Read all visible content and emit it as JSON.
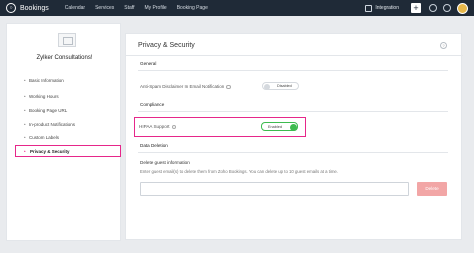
{
  "app": {
    "name": "Bookings"
  },
  "nav": {
    "items": [
      "Calendar",
      "Services",
      "Staff",
      "My Profile",
      "Booking Page"
    ]
  },
  "header": {
    "integration_label": "Integration",
    "plus_label": "+"
  },
  "sidebar": {
    "business_name": "Zylker Consultations!",
    "items": [
      "Basic Information",
      "Working Hours",
      "Booking Page URL",
      "In-product Notifications",
      "Custom Labels",
      "Privacy & Security"
    ],
    "active_index": 5
  },
  "main": {
    "title": "Privacy & Security",
    "general": {
      "heading": "General",
      "anti_spam_label": "Anti-Spam Disclaimer In Email Notification",
      "anti_spam_state": "Disabled"
    },
    "compliance": {
      "heading": "Compliance",
      "hipaa_label": "HIPAA Support",
      "hipaa_state": "Enabled"
    },
    "data_deletion": {
      "heading": "Data Deletion",
      "subheading": "Delete guest information",
      "hint": "Enter guest email(s) to delete them from Zoho Bookings. You can delete up to 10 guest emails at a time.",
      "input_value": "",
      "delete_label": "Delete"
    }
  },
  "colors": {
    "accent": "#e6278a",
    "toggle_on": "#3dbb4f",
    "toggle_off": "#d5d9de",
    "nav_bg": "#1f2a37",
    "delete_btn": "#f2a6a6"
  }
}
